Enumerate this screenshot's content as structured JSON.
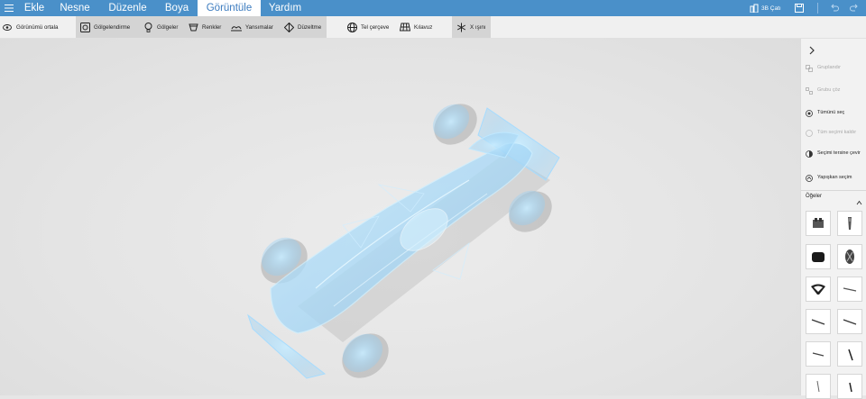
{
  "menu": {
    "hamburger_icon": "hamburger-icon",
    "items": [
      {
        "label": "Ekle"
      },
      {
        "label": "Nesne"
      },
      {
        "label": "Düzenle"
      },
      {
        "label": "Boya"
      },
      {
        "label": "Görüntüle",
        "active": true
      },
      {
        "label": "Yardım"
      }
    ],
    "right": {
      "mode_label": "3B Çatı",
      "save_icon": "save-icon",
      "undo_icon": "undo-icon",
      "redo_icon": "redo-icon"
    }
  },
  "toolbar": {
    "center_view": "Görünümü ortala",
    "shading": "Gölgelendirme",
    "shadows": "Gölgeler",
    "colors": "Renkler",
    "reflections": "Yansımalar",
    "smoothing": "Düzeltme",
    "wireframe": "Tel çerçeve",
    "guide": "Kılavuz",
    "xray": "X ışını"
  },
  "sidebar": {
    "collapse_icon": "chevron-right-icon",
    "actions": [
      {
        "label": "Gruplandır",
        "disabled": true
      },
      {
        "label": "Grubu çöz",
        "disabled": true
      },
      {
        "label": "Tümünü seç",
        "disabled": false
      },
      {
        "label": "Tüm seçimi kaldır",
        "disabled": true
      },
      {
        "label": "Seçimi tersine çevir",
        "disabled": false
      },
      {
        "label": "Yapışkan seçim",
        "disabled": false
      }
    ],
    "objects_header": "Öğeler",
    "objects_collapse_icon": "chevron-up-icon"
  },
  "colors": {
    "accent": "#4a90c9",
    "toolbar_active": "#d4d4d4",
    "xray_glow": "#aee0ff"
  }
}
